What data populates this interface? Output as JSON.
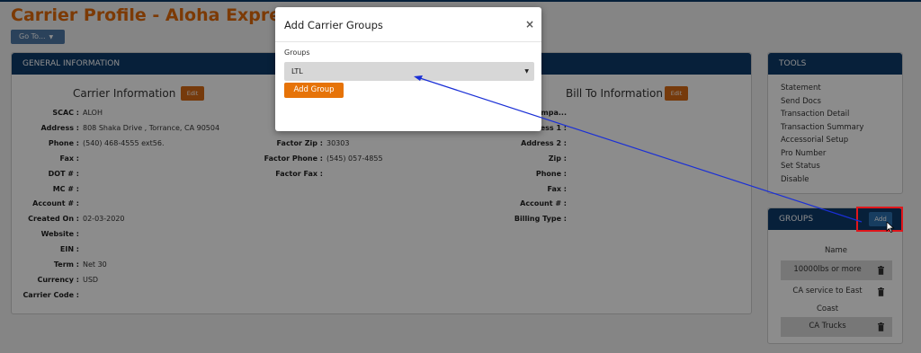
{
  "page": {
    "title": "Carrier Profile - Aloha Express",
    "goto_label": "Go To...",
    "goto_caret": "▼"
  },
  "general": {
    "header": "GENERAL INFORMATION",
    "carrier_title": "Carrier Information",
    "billto_title": "Bill To Information",
    "edit_label": "Edit",
    "carrier_fields": [
      {
        "label": "SCAC :",
        "value": "ALOH"
      },
      {
        "label": "Address :",
        "value": "808 Shaka Drive , Torrance, CA 90504"
      },
      {
        "label": "Phone :",
        "value": "(540) 468-4555 ext56."
      },
      {
        "label": "Fax :",
        "value": ""
      },
      {
        "label": "DOT # :",
        "value": ""
      },
      {
        "label": "MC # :",
        "value": ""
      },
      {
        "label": "Account # :",
        "value": ""
      },
      {
        "label": "Created On :",
        "value": "02-03-2020"
      },
      {
        "label": "Website :",
        "value": ""
      },
      {
        "label": "EIN :",
        "value": ""
      },
      {
        "label": "Term :",
        "value": "Net 30"
      },
      {
        "label": "Currency :",
        "value": "USD"
      },
      {
        "label": "Carrier Code :",
        "value": ""
      }
    ],
    "factor_fields": [
      {
        "label": "Fa",
        "value": ""
      },
      {
        "label": "Fac",
        "value": ""
      },
      {
        "label": "Factor Zip :",
        "value": "30303"
      },
      {
        "label": "Factor Phone :",
        "value": "(545) 057-4855"
      },
      {
        "label": "Factor Fax :",
        "value": ""
      }
    ],
    "billto_fields": [
      {
        "label": "mpa...",
        "value": ""
      },
      {
        "label": "ress 1 :",
        "value": ""
      },
      {
        "label": "Address 2 :",
        "value": ""
      },
      {
        "label": "Zip :",
        "value": ""
      },
      {
        "label": "Phone :",
        "value": ""
      },
      {
        "label": "Fax :",
        "value": ""
      },
      {
        "label": "Account # :",
        "value": ""
      },
      {
        "label": "Billing Type :",
        "value": ""
      }
    ]
  },
  "tools": {
    "header": "TOOLS",
    "items": [
      "Statement",
      "Send Docs",
      "Transaction Detail",
      "Transaction Summary",
      "Accessorial Setup",
      "Pro Number",
      "Set Status",
      "Disable"
    ]
  },
  "groups": {
    "header": "GROUPS",
    "add_label": "Add",
    "name_header": "Name",
    "rows": [
      {
        "name": "10000lbs or more",
        "shaded": true
      },
      {
        "name": "CA service to East",
        "shaded": false
      },
      {
        "name": "Coast",
        "shaded": false
      },
      {
        "name": "CA Trucks",
        "shaded": true
      }
    ]
  },
  "modal": {
    "title": "Add Carrier Groups",
    "close": "×",
    "groups_label": "Groups",
    "selected_group": "LTL",
    "select_arrow": "▼",
    "add_group_label": "Add Group"
  },
  "colors": {
    "accent": "#e26a0a",
    "header_bg": "#0e3b6b",
    "annotation_line": "#1a2fd6",
    "annotation_box": "#e0161b"
  }
}
